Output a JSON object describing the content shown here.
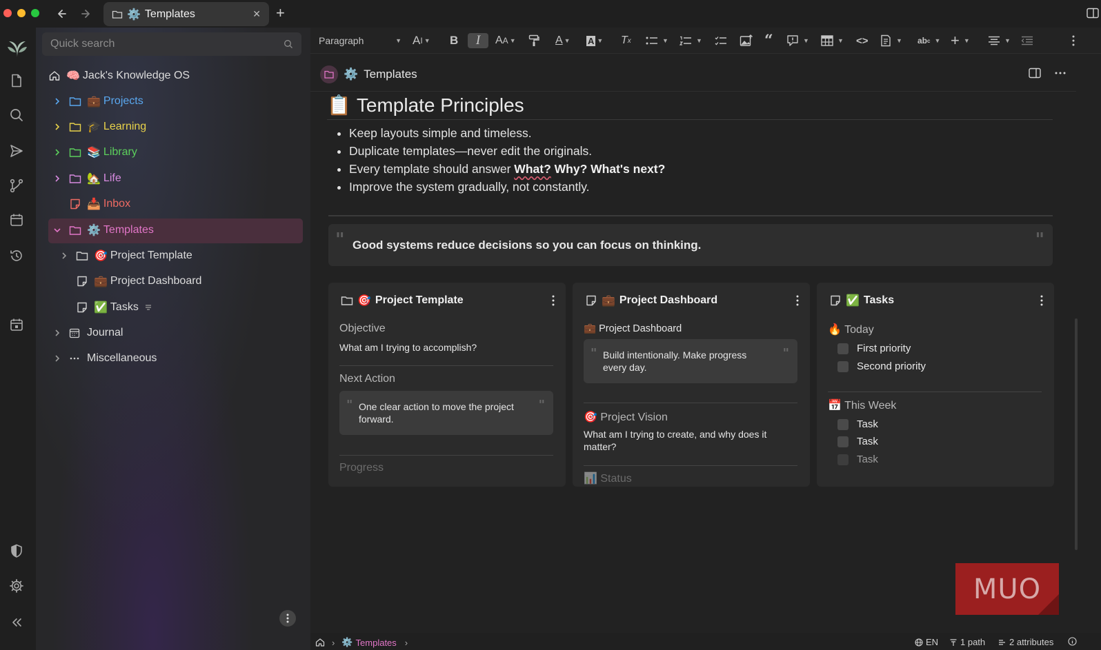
{
  "colors": {
    "projects": "#5aa8f0",
    "learning": "#e8d24a",
    "library": "#5ccf5c",
    "life": "#d88be0",
    "inbox": "#ef6b63",
    "templates": "#e276c8",
    "chevron_gray": "#9a9a9a",
    "selected_bg": "#4a2f3d",
    "accent": "#e276c8"
  },
  "window": {
    "tab_title": "Templates",
    "tab_icon": "gear-icon",
    "tab_emoji": "⚙️"
  },
  "sidebar": {
    "search_placeholder": "Quick search",
    "root": {
      "emoji": "🧠",
      "label": "Jack's Knowledge OS"
    },
    "items": [
      {
        "label": "Projects",
        "emoji": "💼",
        "icon": "folder-icon"
      },
      {
        "label": "Learning",
        "emoji": "🎓",
        "icon": "folder-icon"
      },
      {
        "label": "Library",
        "emoji": "📚",
        "icon": "folder-icon"
      },
      {
        "label": "Life",
        "emoji": "🏡",
        "icon": "folder-icon"
      },
      {
        "label": "Inbox",
        "emoji": "📥",
        "icon": "note-icon"
      },
      {
        "label": "Templates",
        "emoji": "⚙️",
        "icon": "folder-icon",
        "selected": true
      },
      {
        "label": "Project Template",
        "emoji": "🎯",
        "icon": "folder-icon"
      },
      {
        "label": "Project Dashboard",
        "emoji": "💼",
        "icon": "note-icon"
      },
      {
        "label": "Tasks",
        "emoji": "✅",
        "icon": "note-icon"
      },
      {
        "label": "Journal",
        "emoji": "",
        "icon": "calendar-icon"
      },
      {
        "label": "Miscellaneous",
        "emoji": "",
        "icon": "dots-icon"
      }
    ]
  },
  "toolbar": {
    "block_type": "Paragraph",
    "buttons": [
      "text-size",
      "bold",
      "italic",
      "case",
      "format-painter",
      "text-color",
      "highlight",
      "clear-format",
      "bullet-list",
      "numbered-list",
      "todo-list",
      "image",
      "quote",
      "callout",
      "table",
      "code",
      "include-note",
      "spellcheck",
      "insert",
      "align",
      "outdent"
    ]
  },
  "note": {
    "title": "Templates",
    "title_emoji": "⚙️",
    "heading": "Template Principles",
    "heading_emoji": "📋",
    "bullets": [
      "Keep layouts simple and timeless.",
      "Duplicate templates—never edit the originals.",
      "Every template should answer ",
      "Improve the system gradually, not constantly."
    ],
    "bullet3_bold_what": "What?",
    "bullet3_bold_rest": " Why? What's next?",
    "quote": "Good systems reduce decisions so you can focus on thinking."
  },
  "cards": [
    {
      "title": "Project Template",
      "emoji": "🎯",
      "icon": "folder-icon",
      "section1": "Objective",
      "text1": "What am I trying to accomplish?",
      "section2": "Next Action",
      "quote": "One clear action to move the project forward.",
      "section3": "Progress"
    },
    {
      "title": "Project Dashboard",
      "emoji": "💼",
      "icon": "note-icon",
      "sub_emoji": "💼",
      "subtitle": "Project Dashboard",
      "quote": "Build intentionally. Make progress every day.",
      "section2_emoji": "🎯",
      "section2": "Project Vision",
      "text2": "What am I trying to create, and why does it matter?",
      "section3_emoji": "📊",
      "section3": "Status"
    },
    {
      "title": "Tasks",
      "emoji": "✅",
      "icon": "note-icon",
      "group1_emoji": "🔥",
      "group1": "Today",
      "group1_items": [
        "First priority",
        "Second priority"
      ],
      "group2_emoji": "📅",
      "group2": "This Week",
      "group2_items": [
        "Task",
        "Task",
        "Task"
      ]
    }
  ],
  "statusbar": {
    "breadcrumb": "Templates",
    "breadcrumb_emoji": "⚙️",
    "language": "EN",
    "paths": "1 path",
    "attributes": "2 attributes"
  },
  "watermark": "MUO"
}
